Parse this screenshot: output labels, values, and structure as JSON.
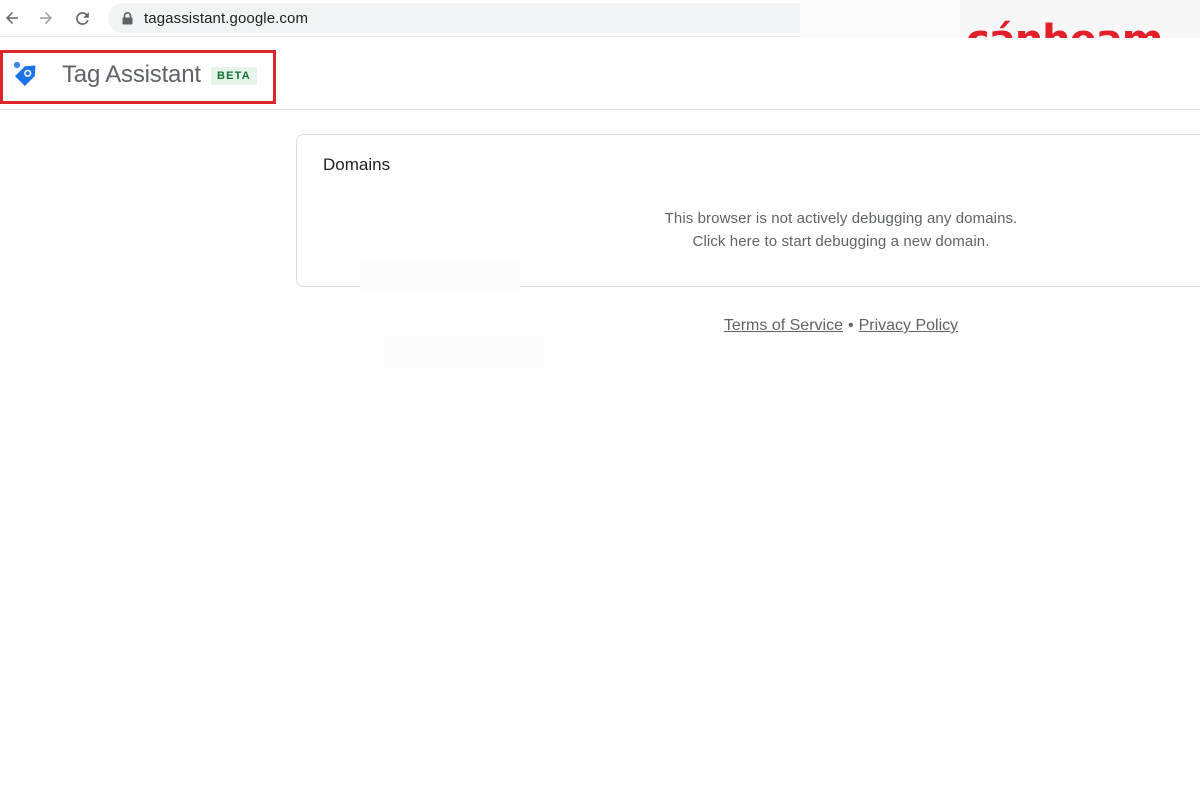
{
  "browser": {
    "url": "tagassistant.google.com"
  },
  "watermark": {
    "text": "cánheam",
    "trademark": "™",
    "color": "#e3202a"
  },
  "header": {
    "title": "Tag Assistant",
    "badge": "BETA",
    "highlight_color": "#e0262d",
    "logo_color": "#1a73e8"
  },
  "domains_card": {
    "title": "Domains",
    "empty_line_1": "This browser is not actively debugging any domains.",
    "empty_line_2": "Click here to start debugging a new domain."
  },
  "footer": {
    "terms_label": "Terms of Service",
    "separator": "•",
    "privacy_label": "Privacy Policy"
  }
}
